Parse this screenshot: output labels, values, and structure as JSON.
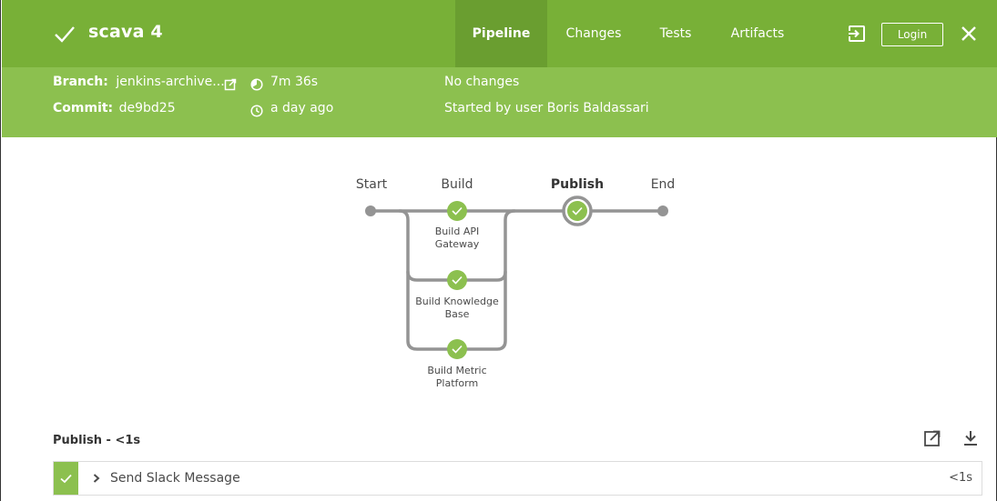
{
  "header": {
    "title": "scava 4",
    "tabs": [
      {
        "label": "Pipeline",
        "active": true
      },
      {
        "label": "Changes",
        "active": false
      },
      {
        "label": "Tests",
        "active": false
      },
      {
        "label": "Artifacts",
        "active": false
      }
    ],
    "login_label": "Login",
    "icons": {
      "status": "check-icon",
      "exit": "exit-icon",
      "close": "close-icon"
    }
  },
  "meta": {
    "branch_label": "Branch:",
    "branch_value": "jenkins-archive...",
    "commit_label": "Commit:",
    "commit_value": "de9bd25",
    "duration": "7m 36s",
    "time_ago": "a day ago",
    "changes": "No changes",
    "started_by": "Started by user Boris Baldassari"
  },
  "pipeline": {
    "stages": [
      "Start",
      "Build",
      "Publish",
      "End"
    ],
    "build_nodes": [
      {
        "label_line1": "Build API",
        "label_line2": "Gateway"
      },
      {
        "label_line1": "Build Knowledge",
        "label_line2": "Base"
      },
      {
        "label_line1": "Build Metric",
        "label_line2": "Platform"
      }
    ]
  },
  "steps": {
    "title": "Publish - <1s",
    "rows": [
      {
        "name": "Send Slack Message",
        "duration": "<1s"
      }
    ]
  },
  "colors": {
    "header_dark": "#78b037",
    "header_light": "#8cc04f",
    "success": "#8cc04f",
    "line": "#949494"
  }
}
